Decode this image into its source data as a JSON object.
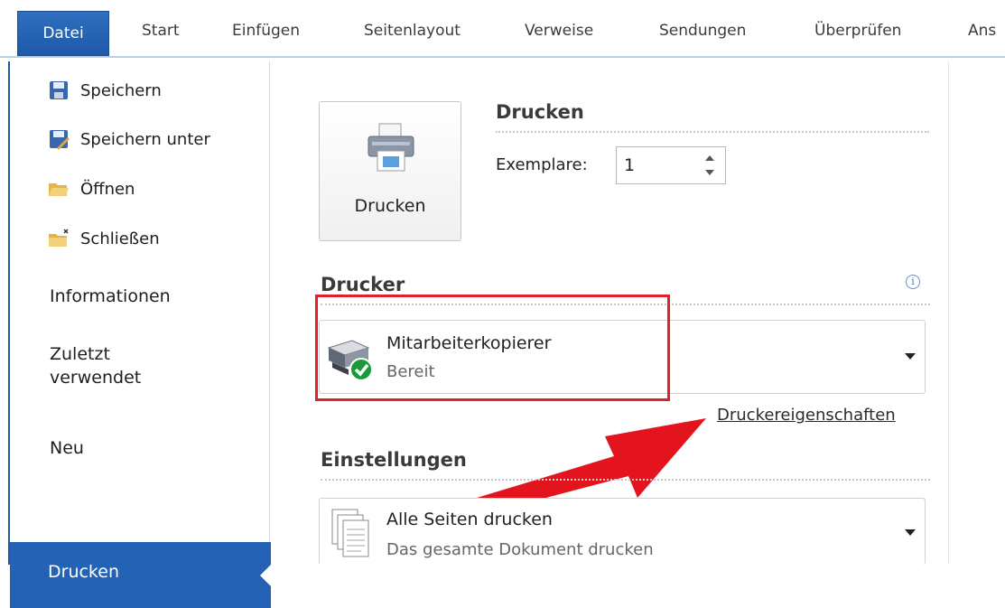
{
  "ribbon": {
    "file_tab": "Datei",
    "tabs": [
      "Start",
      "Einfügen",
      "Seitenlayout",
      "Verweise",
      "Sendungen",
      "Überprüfen",
      "Ans"
    ]
  },
  "nav": {
    "commands": [
      {
        "label": "Speichern",
        "icon": "save-icon"
      },
      {
        "label": "Speichern unter",
        "icon": "save-as-icon"
      },
      {
        "label": "Öffnen",
        "icon": "open-folder-icon"
      },
      {
        "label": "Schließen",
        "icon": "close-folder-icon"
      }
    ],
    "items": [
      "Informationen",
      "Zuletzt verwendet",
      "Neu"
    ],
    "active": "Drucken"
  },
  "print": {
    "section_title": "Drucken",
    "button_label": "Drucken",
    "copies_label": "Exemplare:",
    "copies_value": "1"
  },
  "printer": {
    "section_title": "Drucker",
    "name": "Mitarbeiterkopierer",
    "status": "Bereit",
    "properties_link": "Druckereigenschaften"
  },
  "settings": {
    "section_title": "Einstellungen",
    "pages_main": "Alle Seiten drucken",
    "pages_sub": "Das gesamte Dokument drucken"
  },
  "colors": {
    "accent": "#2462b5",
    "highlight": "#e0202a",
    "arrow": "#e3141e",
    "ready_check": "#1a9a3a"
  }
}
